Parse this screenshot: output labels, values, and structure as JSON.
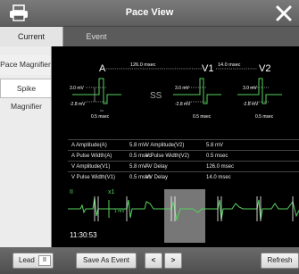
{
  "window": {
    "title": "Pace View",
    "print_icon": "printer-icon",
    "close_icon": "close-icon"
  },
  "tabs": [
    {
      "label": "Current",
      "active": true
    },
    {
      "label": "Event",
      "active": false
    }
  ],
  "sidebar": {
    "items": [
      {
        "label": "Pace Magnifier",
        "selected": false
      },
      {
        "label": "Spike Magnifier",
        "selected": true
      }
    ]
  },
  "magnifier": {
    "labels": {
      "a": "A",
      "v1": "V1",
      "v2": "V2"
    },
    "av_interval": "126.0 msec",
    "vv_interval": "14.0 msec",
    "left": {
      "amp_top": "3.0 mV",
      "amp_bottom": "-2.8 mV",
      "width": "0.5 msec"
    },
    "mid": {
      "amp_top": "3.0 mV",
      "amp_bottom": "-2.8 mV",
      "width": "0.5 msec"
    },
    "right": {
      "amp_top": "3.0 mV",
      "amp_bottom": "-2.8 mV",
      "width": "0.5 msec"
    }
  },
  "measurements": [
    {
      "l1": "A Amplitude(A)",
      "v1": "5.8 mV",
      "l2": "V Amplitude(V2)",
      "v2": "5.8 mV"
    },
    {
      "l1": "A Pulse Width(A)",
      "v1": "0.5 msec",
      "l2": "V Pulse Width(V2)",
      "v2": "0.5 msec"
    },
    {
      "l1": "V Amplitude(V1)",
      "v1": "5.8 mV",
      "l2": "AV Delay",
      "v2": "126.0 msec"
    },
    {
      "l1": "V Pulse Width(V1)",
      "v1": "0.5 msec",
      "l2": "VV Delay",
      "v2": "14.0 msec"
    }
  ],
  "strip": {
    "lead": "II",
    "gain": "x1",
    "time": "11:30:53",
    "scale": "1 mV"
  },
  "bottom": {
    "lead_label": "Lead",
    "lead_value": "II",
    "save_label": "Save As Event",
    "prev": "<",
    "next": ">",
    "refresh_label": "Refresh"
  },
  "colors": {
    "ecg": "#56d25e",
    "pace_marker": "#ffffff",
    "highlight": "#777777"
  }
}
